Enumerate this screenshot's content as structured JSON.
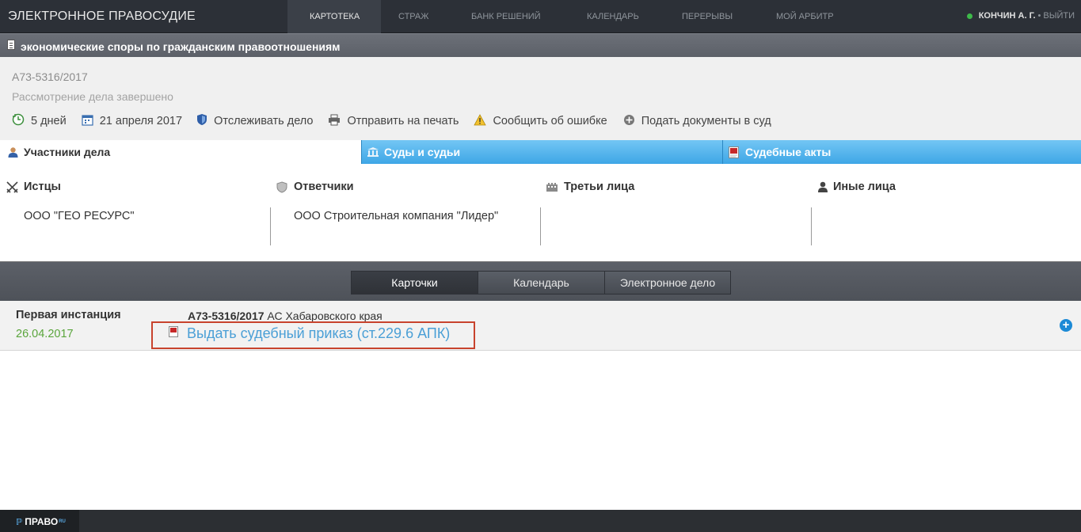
{
  "nav": {
    "brand": "ЭЛЕКТРОННОЕ ПРАВОСУДИЕ",
    "items": [
      {
        "label": "КАРТОТЕКА"
      },
      {
        "label": "СТРАЖ"
      },
      {
        "label": "БАНК РЕШЕНИЙ"
      },
      {
        "label": "КАЛЕНДАРЬ"
      },
      {
        "label": "ПЕРЕРЫВЫ"
      },
      {
        "label": "МОЙ АРБИТР"
      }
    ],
    "user_name": "КОНЧИН А. Г.",
    "separator": "•",
    "logout": "ВЫЙТИ",
    "status_color": "#3eb94a"
  },
  "category": {
    "title": "экономические споры по гражданским правоотношениям",
    "icon": "document-icon"
  },
  "case": {
    "number": "А73-5316/2017",
    "status": "Рассмотрение дела завершено",
    "actions": [
      {
        "label": "5 дней",
        "icon": "clock-icon"
      },
      {
        "label": "21 апреля 2017",
        "icon": "calendar-icon"
      },
      {
        "label": "Отслеживать дело",
        "icon": "shield-icon"
      },
      {
        "label": "Отправить на печать",
        "icon": "printer-icon"
      },
      {
        "label": "Сообщить об ошибке",
        "icon": "warning-icon"
      },
      {
        "label": "Подать документы в суд",
        "icon": "plus-circle-icon"
      }
    ]
  },
  "tabs": [
    {
      "label": "Участники дела",
      "icon": "person-icon"
    },
    {
      "label": "Суды и судьи",
      "icon": "court-icon"
    },
    {
      "label": "Судебные акты",
      "icon": "pdf-icon"
    }
  ],
  "participants": {
    "plaintiffs": {
      "label": "Истцы",
      "value": "ООО \"ГЕО РЕСУРС\""
    },
    "defendants": {
      "label": "Ответчики",
      "value": "ООО Строительная компания \"Лидер\""
    },
    "third": {
      "label": "Третьи лица",
      "value": ""
    },
    "others": {
      "label": "Иные лица",
      "value": ""
    }
  },
  "views": [
    {
      "label": "Карточки"
    },
    {
      "label": "Календарь"
    },
    {
      "label": "Электронное дело"
    }
  ],
  "instance": {
    "title": "Первая инстанция",
    "date": "26.04.2017",
    "case_number": "А73-5316/2017",
    "court": "АС Хабаровского края",
    "document": "Выдать судебный приказ (ст.229.6 АПК)",
    "link_color": "#4a9fd6",
    "highlight_color": "#c8432d"
  },
  "footer": {
    "logo": "ПРАВО",
    "logo_suffix": "RU"
  }
}
